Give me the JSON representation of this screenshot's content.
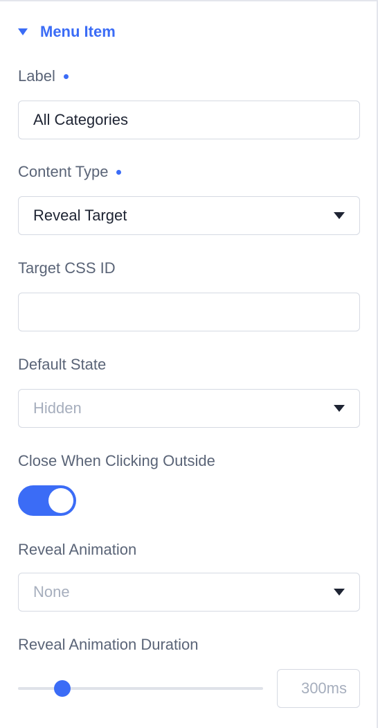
{
  "section": {
    "title": "Menu Item",
    "expanded": true
  },
  "fields": {
    "label": {
      "title": "Label",
      "required": true,
      "value": "All Categories"
    },
    "content_type": {
      "title": "Content Type",
      "required": true,
      "value": "Reveal Target"
    },
    "target_css_id": {
      "title": "Target CSS ID",
      "value": ""
    },
    "default_state": {
      "title": "Default State",
      "value": "Hidden"
    },
    "close_outside": {
      "title": "Close When Clicking Outside",
      "enabled": true
    },
    "reveal_animation": {
      "title": "Reveal Animation",
      "value": "None"
    },
    "reveal_duration": {
      "title": "Reveal Animation Duration",
      "value_text": "300ms",
      "slider_fraction": 0.18
    }
  },
  "colors": {
    "accent": "#3b6cf6",
    "label_text": "#5a6477",
    "placeholder_text": "#a6aebd",
    "border": "#d5d9e2"
  },
  "icons": {
    "section_toggle": "caret-down-icon",
    "select_arrow": "triangle-down-icon"
  }
}
